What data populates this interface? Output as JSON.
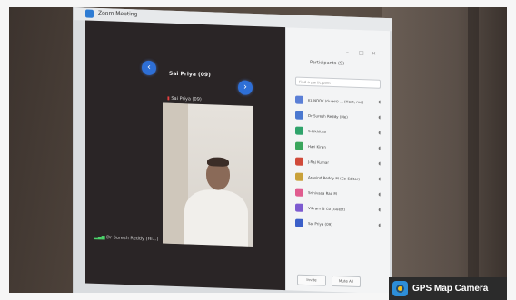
{
  "window": {
    "title": "Zoom Meeting"
  },
  "video": {
    "speaker_title": "Sai Priya (09)",
    "speaker_sub": "Sai Priya (09)",
    "caption": "Dr Suresh Reddy (Hi...)"
  },
  "participants": {
    "title": "Participants (9)",
    "search_placeholder": "Find a participant",
    "items": [
      {
        "label": "KL NDDY (Guest) ... (Host, me)",
        "color": "#5b7fd6"
      },
      {
        "label": "Dr Suresh Reddy (Me)",
        "color": "#4a78d0"
      },
      {
        "label": "S-Likhitha",
        "color": "#2fa36b"
      },
      {
        "label": "Hari Kiran",
        "color": "#3aa55c"
      },
      {
        "label": "J-Raj Kumar",
        "color": "#d04a3a"
      },
      {
        "label": "Aravind Reddy M (Co-Editor)",
        "color": "#c9a13a"
      },
      {
        "label": "Srinivasa Rao M",
        "color": "#e05c8f"
      },
      {
        "label": "Vikram & Co (Guest)",
        "color": "#7d5bd0"
      },
      {
        "label": "Sai Priya (09)",
        "color": "#3b5fc8"
      }
    ],
    "footer_invite": "Invite",
    "footer_mute": "Mute All"
  },
  "watermark": {
    "text": "GPS Map Camera"
  }
}
